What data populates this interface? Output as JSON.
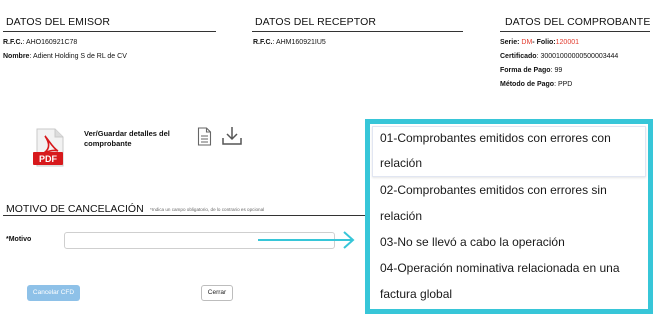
{
  "emisor": {
    "heading": "DATOS DEL EMISOR",
    "rfc_label": "R.F.C.",
    "rfc_value": ": AHO160921C78",
    "nombre_label": "Nombre",
    "nombre_value": ": Adient Holding S de RL de CV"
  },
  "receptor": {
    "heading": "DATOS DEL RECEPTOR",
    "rfc_label": "R.F.C.",
    "rfc_value": ": AHM160921IU5"
  },
  "comprobante": {
    "heading": "DATOS DEL COMPROBANTE",
    "serie_label": "Serie",
    "serie_sep": ": ",
    "serie_value": "DM",
    "folio_label": "- Folio",
    "folio_sep": ":",
    "folio_value": "120001",
    "certificado_label": "Certificado",
    "certificado_value": ": 30001000000500003444",
    "forma_pago_label": "Forma de Pago",
    "forma_pago_value": ": 99",
    "metodo_pago_label": "Método de Pago",
    "metodo_pago_value": ": PPD"
  },
  "pdf": {
    "icon_text": "PDF",
    "label": "Ver/Guardar detalles del comprobante"
  },
  "motivo": {
    "title": "MOTIVO DE CANCELACIÓN",
    "note": "*Indica un campo obligatorio, de lo contrario es opcional",
    "label": "*Motivo",
    "input_value": ""
  },
  "buttons": {
    "cancel_cfd": "Cancelar CFD",
    "cerrar": "Cerrar"
  },
  "dropdown": {
    "items": [
      {
        "line1": "01-Comprobantes emitidos con errores con",
        "line2": "relación"
      },
      {
        "line1": "02-Comprobantes emitidos con errores sin",
        "line2": "relación"
      },
      {
        "line1": "03-No se llevó a cabo la operación"
      },
      {
        "line1": "04-Operación nominativa relacionada en una",
        "line2": "factura global"
      }
    ]
  },
  "colors": {
    "highlight_border": "#37c6d8",
    "arrow": "#37c6d8",
    "accent_red": "#e23b2e",
    "primary_button": "#8ec1e8"
  },
  "icons": [
    "pdf-icon",
    "document-icon",
    "download-icon",
    "arrow-right-icon"
  ]
}
